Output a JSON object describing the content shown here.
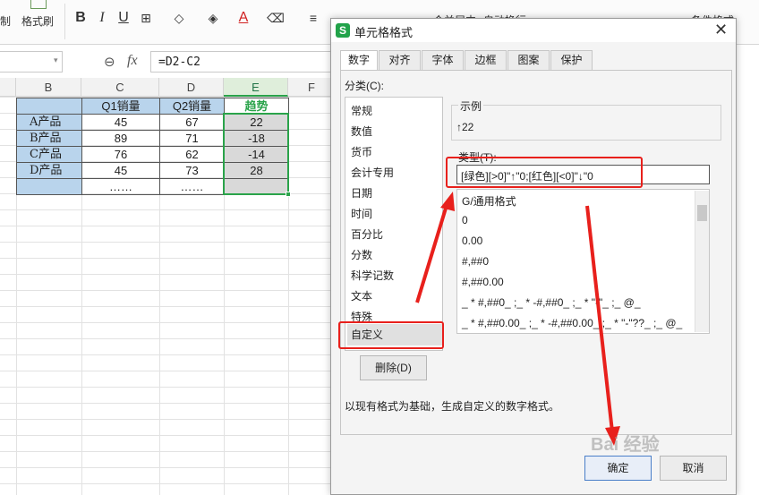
{
  "ribbon": {
    "copy_label": "制",
    "format_painter_label": "格式刷",
    "bold": "B",
    "italic": "I",
    "underline": "U",
    "font_color_glyph": "A",
    "align_label": "合并居中",
    "wrap_label": "自动换行",
    "cond_format_label": "条件格式"
  },
  "formula_bar": {
    "fx": "fx",
    "formula": "=D2-C2"
  },
  "sheet": {
    "columns": [
      "B",
      "C",
      "D",
      "E",
      "F"
    ],
    "header_row": [
      "",
      "Q1销量",
      "Q2销量",
      "趋势"
    ],
    "rows": [
      {
        "product": "A产品",
        "q1": "45",
        "q2": "67",
        "trend": "22"
      },
      {
        "product": "B产品",
        "q1": "89",
        "q2": "71",
        "trend": "-18"
      },
      {
        "product": "C产品",
        "q1": "76",
        "q2": "62",
        "trend": "-14"
      },
      {
        "product": "D产品",
        "q1": "45",
        "q2": "73",
        "trend": "28"
      },
      {
        "product": "",
        "q1": "……",
        "q2": "……",
        "trend": ""
      }
    ]
  },
  "dialog": {
    "title": "单元格格式",
    "logo": "S",
    "close": "✕",
    "tabs": [
      "数字",
      "对齐",
      "字体",
      "边框",
      "图案",
      "保护"
    ],
    "category_label": "分类(C):",
    "categories": [
      "常规",
      "数值",
      "货币",
      "会计专用",
      "日期",
      "时间",
      "百分比",
      "分数",
      "科学记数",
      "文本",
      "特殊",
      "自定义"
    ],
    "selected_category": "自定义",
    "sample_label": "示例",
    "sample_value": "↑22",
    "type_label": "类型(T):",
    "type_value": "[绿色][>0]\"↑\"0;[红色][<0]\"↓\"0",
    "formats": [
      "G/通用格式",
      "0",
      "0.00",
      "#,##0",
      "#,##0.00",
      "_ * #,##0_ ;_ * -#,##0_ ;_ * \"-\"_ ;_ @_",
      "_ * #,##0.00_ ;_ * -#,##0.00_ ;_ * \"-\"??_ ;_ @_"
    ],
    "delete_button": "删除(D)",
    "description": "以现有格式为基础，生成自定义的数字格式。",
    "ok_button": "确定",
    "cancel_button": "取消"
  },
  "watermark": "Bai 经验",
  "colors": {
    "accent_green": "#2aa34a",
    "annotation_red": "#e8201c",
    "header_blue": "#b9d4ec"
  }
}
